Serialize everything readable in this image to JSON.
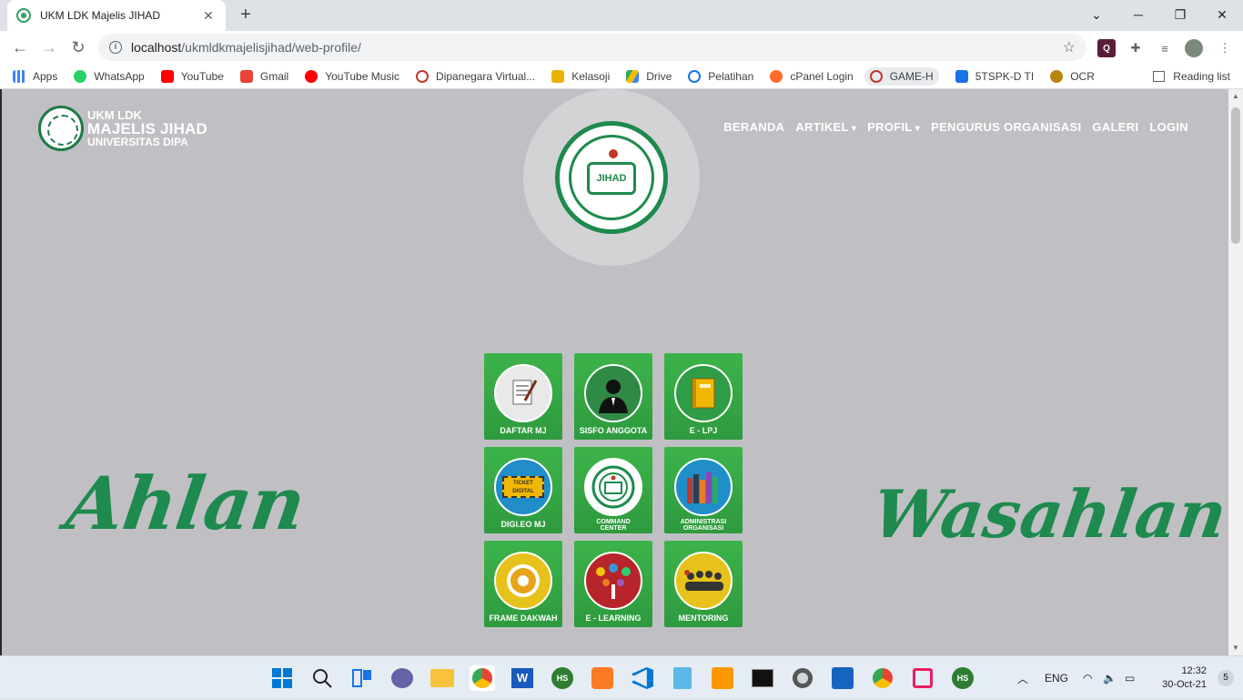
{
  "browser": {
    "tab_title": "UKM LDK Majelis JIHAD",
    "url_host": "localhost",
    "url_path": "/ukmldkmajelisjihad/web-profile/",
    "bookmarks": [
      {
        "label": "Apps",
        "icon": "apps-grid-icon",
        "color": "#4285f4"
      },
      {
        "label": "WhatsApp",
        "icon": "whatsapp-icon",
        "color": "#25d366"
      },
      {
        "label": "YouTube",
        "icon": "youtube-icon",
        "color": "#ff0000"
      },
      {
        "label": "Gmail",
        "icon": "gmail-icon",
        "color": "#ea4335"
      },
      {
        "label": "YouTube Music",
        "icon": "youtube-music-icon",
        "color": "#ff0000"
      },
      {
        "label": "Dipanegara Virtual...",
        "icon": "dipanegara-icon",
        "color": "#c0392b"
      },
      {
        "label": "Kelasoji",
        "icon": "kelasoji-icon",
        "color": "#e8b400"
      },
      {
        "label": "Drive",
        "icon": "google-drive-icon",
        "color": "#34a853"
      },
      {
        "label": "Pelatihan",
        "icon": "pelatihan-icon",
        "color": "#1a73e8"
      },
      {
        "label": "cPanel Login",
        "icon": "cpanel-icon",
        "color": "#ff6c2c"
      },
      {
        "label": "GAME-H",
        "icon": "game-h-icon",
        "color": "#c0392b"
      },
      {
        "label": "5TSPK-D TI",
        "icon": "5tspk-icon",
        "color": "#1a73e8"
      },
      {
        "label": "OCR",
        "icon": "ocr-icon",
        "color": "#b8860b"
      }
    ],
    "reading_list": "Reading list"
  },
  "site": {
    "brand": {
      "line1": "UKM LDK",
      "line2": "MAJELIS JIHAD",
      "line3": "UNIVERSITAS DIPA"
    },
    "nav": [
      {
        "label": "BERANDA",
        "dropdown": false
      },
      {
        "label": "ARTIKEL",
        "dropdown": true
      },
      {
        "label": "PROFIL",
        "dropdown": true
      },
      {
        "label": "PENGURUS ORGANISASI",
        "dropdown": false
      },
      {
        "label": "GALERI",
        "dropdown": false
      },
      {
        "label": "LOGIN",
        "dropdown": false
      }
    ],
    "emblem_text": "JIHAD",
    "greeting_left": "Ahlan",
    "greeting_right": "Wasahlan",
    "tiles": [
      {
        "label": "DAFTAR MJ",
        "icon": "document-pen-icon",
        "bg": "#e9e9e9"
      },
      {
        "label": "SISFO ANGGOTA",
        "icon": "person-suit-icon",
        "bg": "#2f8a45"
      },
      {
        "label": "E - LPJ",
        "icon": "book-icon",
        "bg": "#2f9c48"
      },
      {
        "label": "DIGI.EO MJ",
        "icon": "ticket-icon",
        "bg": "#1f8ec9",
        "ticket_text": "TICKET DIGITAL"
      },
      {
        "label": "COMMAND CENTER",
        "icon": "majelis-logo-icon",
        "bg": "#ffffff"
      },
      {
        "label": "ADMINISTRASI ORGANISASI",
        "icon": "binders-icon",
        "bg": "#1f8ec9"
      },
      {
        "label": "FRAME DAKWAH",
        "icon": "camera-aperture-icon",
        "bg": "#e6c21b"
      },
      {
        "label": "E - LEARNING",
        "icon": "learning-tree-icon",
        "bg": "#b7242a"
      },
      {
        "label": "MENTORING",
        "icon": "group-people-icon",
        "bg": "#e6c21b"
      }
    ]
  },
  "taskbar": {
    "language": "ENG",
    "time": "12:32",
    "date": "30-Oct-21",
    "notifications": "5",
    "apps": [
      "start-icon",
      "search-icon",
      "task-view-icon",
      "chat-icon",
      "file-explorer-icon",
      "chrome-icon",
      "word-icon",
      "hs-icon",
      "xampp-icon",
      "vscode-icon",
      "notepad-icon",
      "sublime-icon",
      "terminal-icon",
      "settings-icon",
      "media-player-icon",
      "chrome-icon",
      "snipping-tool-icon",
      "hs-icon"
    ]
  }
}
